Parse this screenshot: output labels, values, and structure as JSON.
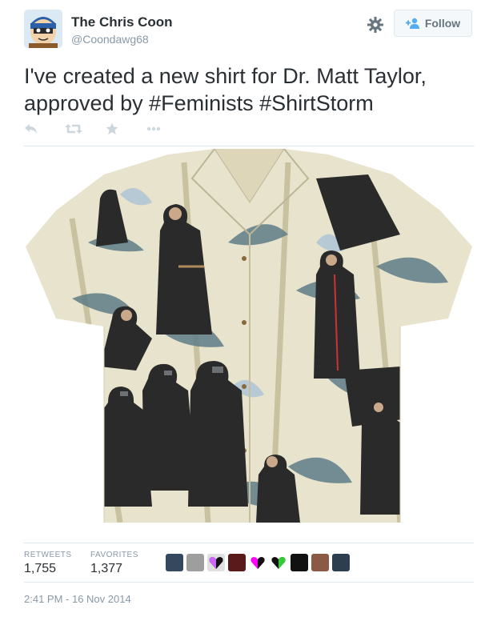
{
  "user": {
    "display_name": "The Chris Coon",
    "screen_name": "@Coondawg68"
  },
  "follow_button": {
    "label": "Follow"
  },
  "tweet": {
    "text_line1": "I've created a new shirt for Dr. Matt Taylor,",
    "text_line2_prefix": "approved by ",
    "hashtag1": "#Feminists",
    "hashtag2": "#ShirtStorm"
  },
  "actions": [
    "reply-icon",
    "retweet-icon",
    "favorite-icon",
    "more-icon"
  ],
  "stats": {
    "retweets_label": "RETWEETS",
    "retweets_value": "1,755",
    "favorites_label": "FAVORITES",
    "favorites_value": "1,377"
  },
  "timestamp": "2:41 PM - 16 Nov 2014",
  "colors": {
    "text": "#292f33",
    "muted": "#8899a6",
    "shirt_base": "#e8e3cc",
    "abaya": "#2a2a2a"
  }
}
